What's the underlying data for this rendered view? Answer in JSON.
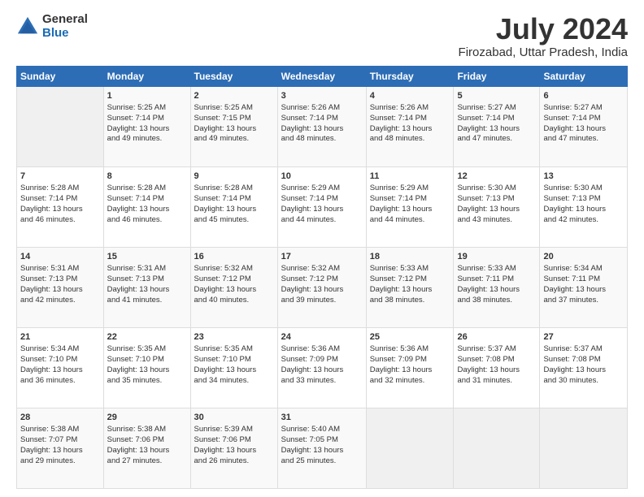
{
  "header": {
    "logo_general": "General",
    "logo_blue": "Blue",
    "month_title": "July 2024",
    "location": "Firozabad, Uttar Pradesh, India"
  },
  "days_of_week": [
    "Sunday",
    "Monday",
    "Tuesday",
    "Wednesday",
    "Thursday",
    "Friday",
    "Saturday"
  ],
  "weeks": [
    [
      {
        "day": "",
        "info": ""
      },
      {
        "day": "1",
        "info": "Sunrise: 5:25 AM\nSunset: 7:14 PM\nDaylight: 13 hours\nand 49 minutes."
      },
      {
        "day": "2",
        "info": "Sunrise: 5:25 AM\nSunset: 7:15 PM\nDaylight: 13 hours\nand 49 minutes."
      },
      {
        "day": "3",
        "info": "Sunrise: 5:26 AM\nSunset: 7:14 PM\nDaylight: 13 hours\nand 48 minutes."
      },
      {
        "day": "4",
        "info": "Sunrise: 5:26 AM\nSunset: 7:14 PM\nDaylight: 13 hours\nand 48 minutes."
      },
      {
        "day": "5",
        "info": "Sunrise: 5:27 AM\nSunset: 7:14 PM\nDaylight: 13 hours\nand 47 minutes."
      },
      {
        "day": "6",
        "info": "Sunrise: 5:27 AM\nSunset: 7:14 PM\nDaylight: 13 hours\nand 47 minutes."
      }
    ],
    [
      {
        "day": "7",
        "info": "Sunrise: 5:28 AM\nSunset: 7:14 PM\nDaylight: 13 hours\nand 46 minutes."
      },
      {
        "day": "8",
        "info": "Sunrise: 5:28 AM\nSunset: 7:14 PM\nDaylight: 13 hours\nand 46 minutes."
      },
      {
        "day": "9",
        "info": "Sunrise: 5:28 AM\nSunset: 7:14 PM\nDaylight: 13 hours\nand 45 minutes."
      },
      {
        "day": "10",
        "info": "Sunrise: 5:29 AM\nSunset: 7:14 PM\nDaylight: 13 hours\nand 44 minutes."
      },
      {
        "day": "11",
        "info": "Sunrise: 5:29 AM\nSunset: 7:14 PM\nDaylight: 13 hours\nand 44 minutes."
      },
      {
        "day": "12",
        "info": "Sunrise: 5:30 AM\nSunset: 7:13 PM\nDaylight: 13 hours\nand 43 minutes."
      },
      {
        "day": "13",
        "info": "Sunrise: 5:30 AM\nSunset: 7:13 PM\nDaylight: 13 hours\nand 42 minutes."
      }
    ],
    [
      {
        "day": "14",
        "info": "Sunrise: 5:31 AM\nSunset: 7:13 PM\nDaylight: 13 hours\nand 42 minutes."
      },
      {
        "day": "15",
        "info": "Sunrise: 5:31 AM\nSunset: 7:13 PM\nDaylight: 13 hours\nand 41 minutes."
      },
      {
        "day": "16",
        "info": "Sunrise: 5:32 AM\nSunset: 7:12 PM\nDaylight: 13 hours\nand 40 minutes."
      },
      {
        "day": "17",
        "info": "Sunrise: 5:32 AM\nSunset: 7:12 PM\nDaylight: 13 hours\nand 39 minutes."
      },
      {
        "day": "18",
        "info": "Sunrise: 5:33 AM\nSunset: 7:12 PM\nDaylight: 13 hours\nand 38 minutes."
      },
      {
        "day": "19",
        "info": "Sunrise: 5:33 AM\nSunset: 7:11 PM\nDaylight: 13 hours\nand 38 minutes."
      },
      {
        "day": "20",
        "info": "Sunrise: 5:34 AM\nSunset: 7:11 PM\nDaylight: 13 hours\nand 37 minutes."
      }
    ],
    [
      {
        "day": "21",
        "info": "Sunrise: 5:34 AM\nSunset: 7:10 PM\nDaylight: 13 hours\nand 36 minutes."
      },
      {
        "day": "22",
        "info": "Sunrise: 5:35 AM\nSunset: 7:10 PM\nDaylight: 13 hours\nand 35 minutes."
      },
      {
        "day": "23",
        "info": "Sunrise: 5:35 AM\nSunset: 7:10 PM\nDaylight: 13 hours\nand 34 minutes."
      },
      {
        "day": "24",
        "info": "Sunrise: 5:36 AM\nSunset: 7:09 PM\nDaylight: 13 hours\nand 33 minutes."
      },
      {
        "day": "25",
        "info": "Sunrise: 5:36 AM\nSunset: 7:09 PM\nDaylight: 13 hours\nand 32 minutes."
      },
      {
        "day": "26",
        "info": "Sunrise: 5:37 AM\nSunset: 7:08 PM\nDaylight: 13 hours\nand 31 minutes."
      },
      {
        "day": "27",
        "info": "Sunrise: 5:37 AM\nSunset: 7:08 PM\nDaylight: 13 hours\nand 30 minutes."
      }
    ],
    [
      {
        "day": "28",
        "info": "Sunrise: 5:38 AM\nSunset: 7:07 PM\nDaylight: 13 hours\nand 29 minutes."
      },
      {
        "day": "29",
        "info": "Sunrise: 5:38 AM\nSunset: 7:06 PM\nDaylight: 13 hours\nand 27 minutes."
      },
      {
        "day": "30",
        "info": "Sunrise: 5:39 AM\nSunset: 7:06 PM\nDaylight: 13 hours\nand 26 minutes."
      },
      {
        "day": "31",
        "info": "Sunrise: 5:40 AM\nSunset: 7:05 PM\nDaylight: 13 hours\nand 25 minutes."
      },
      {
        "day": "",
        "info": ""
      },
      {
        "day": "",
        "info": ""
      },
      {
        "day": "",
        "info": ""
      }
    ]
  ]
}
